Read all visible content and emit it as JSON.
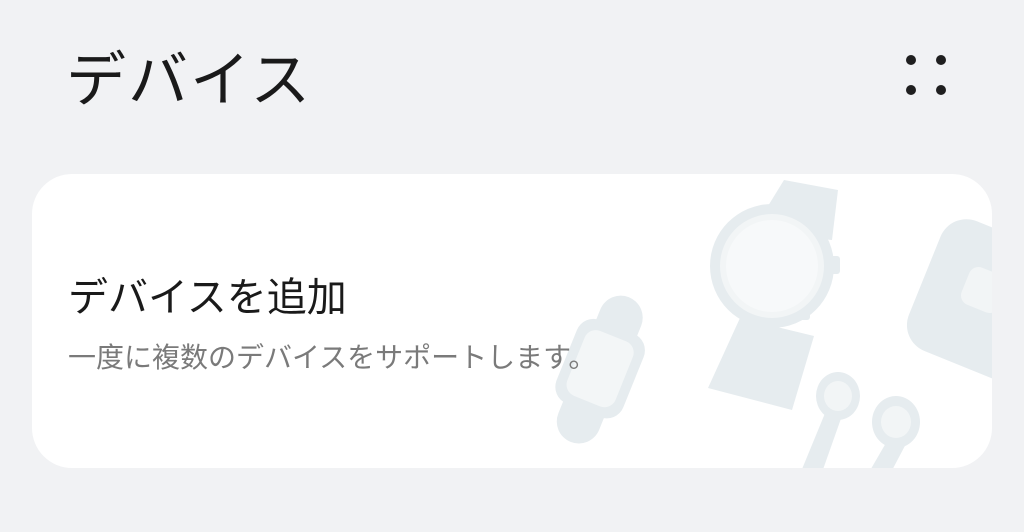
{
  "header": {
    "title": "デバイス",
    "more_icon": "four-dots-more-icon"
  },
  "add_device_card": {
    "title": "デバイスを追加",
    "subtitle": "一度に複数のデバイスをサポートします。",
    "illustration_icons": [
      "smartwatch-icon",
      "fitness-band-icon",
      "earbuds-icon",
      "tablet-icon"
    ]
  },
  "colors": {
    "background": "#f1f2f4",
    "card": "#ffffff",
    "title_text": "#1a1a1a",
    "subtitle_text": "#7a7a7a",
    "illustration": "#e6ecef"
  }
}
